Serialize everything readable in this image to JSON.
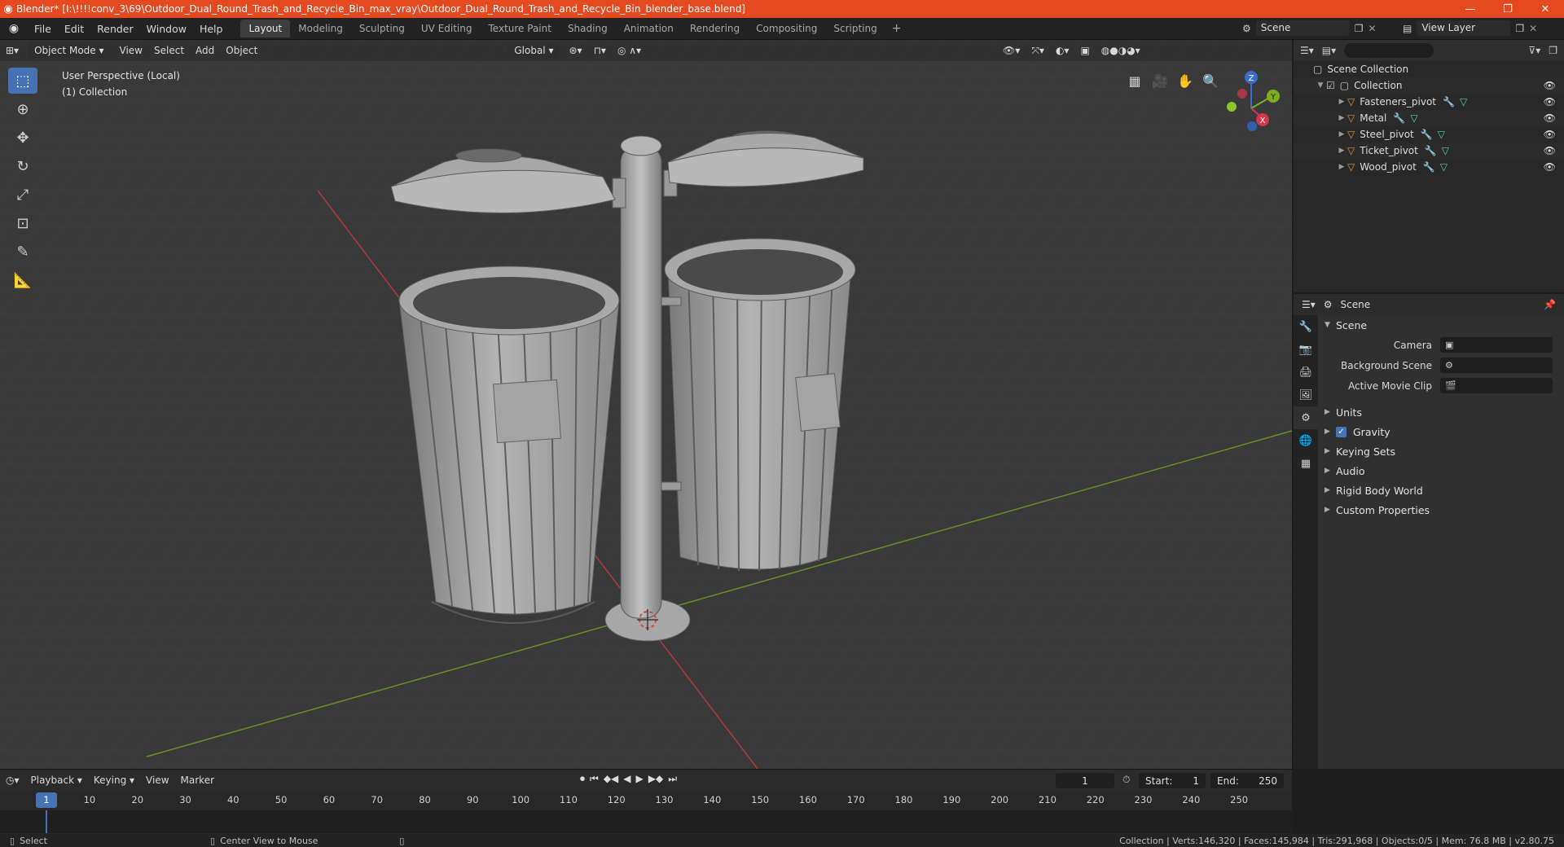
{
  "window": {
    "title": "Blender* [I:\\!!!!conv_3\\69\\Outdoor_Dual_Round_Trash_and_Recycle_Bin_max_vray\\Outdoor_Dual_Round_Trash_and_Recycle_Bin_blender_base.blend]",
    "minimize": "—",
    "maximize": "❐",
    "close": "✕"
  },
  "menu": [
    "File",
    "Edit",
    "Render",
    "Window",
    "Help"
  ],
  "workspaces": [
    "Layout",
    "Modeling",
    "Sculpting",
    "UV Editing",
    "Texture Paint",
    "Shading",
    "Animation",
    "Rendering",
    "Compositing",
    "Scripting"
  ],
  "active_workspace": "Layout",
  "scene_selector": "Scene",
  "view_layer": "View Layer",
  "viewport": {
    "mode": "Object Mode",
    "menus": [
      "View",
      "Select",
      "Add",
      "Object"
    ],
    "orientation": "Global",
    "perspective_label": "User Perspective (Local)",
    "collection_label": "(1) Collection",
    "axis_labels": {
      "x": "X",
      "y": "Y",
      "z": "Z"
    }
  },
  "outliner": {
    "search_placeholder": "",
    "root": "Scene Collection",
    "collection": "Collection",
    "objects": [
      "Fasteners_pivot",
      "Metal",
      "Steel_pivot",
      "Ticket_pivot",
      "Wood_pivot"
    ]
  },
  "properties": {
    "header": "Scene",
    "section": "Scene",
    "fields": [
      {
        "label": "Camera",
        "value": ""
      },
      {
        "label": "Background Scene",
        "value": ""
      },
      {
        "label": "Active Movie Clip",
        "value": ""
      }
    ],
    "panels": [
      "Units",
      "Gravity",
      "Keying Sets",
      "Audio",
      "Rigid Body World",
      "Custom Properties"
    ]
  },
  "timeline": {
    "menus": [
      "Playback",
      "Keying",
      "View",
      "Marker"
    ],
    "current_frame": "1",
    "start_label": "Start:",
    "start": "1",
    "end_label": "End:",
    "end": "250",
    "ticks": [
      "10",
      "20",
      "30",
      "40",
      "50",
      "60",
      "70",
      "80",
      "90",
      "100",
      "110",
      "120",
      "130",
      "140",
      "150",
      "160",
      "170",
      "180",
      "190",
      "200",
      "210",
      "220",
      "230",
      "240",
      "250"
    ]
  },
  "statusbar": {
    "select": "Select",
    "center_view": "Center View to Mouse",
    "stats": "Collection | Verts:146,320 | Faces:145,984 | Tris:291,968 | Objects:0/5 | Mem: 76.8 MB | v2.80.75"
  }
}
